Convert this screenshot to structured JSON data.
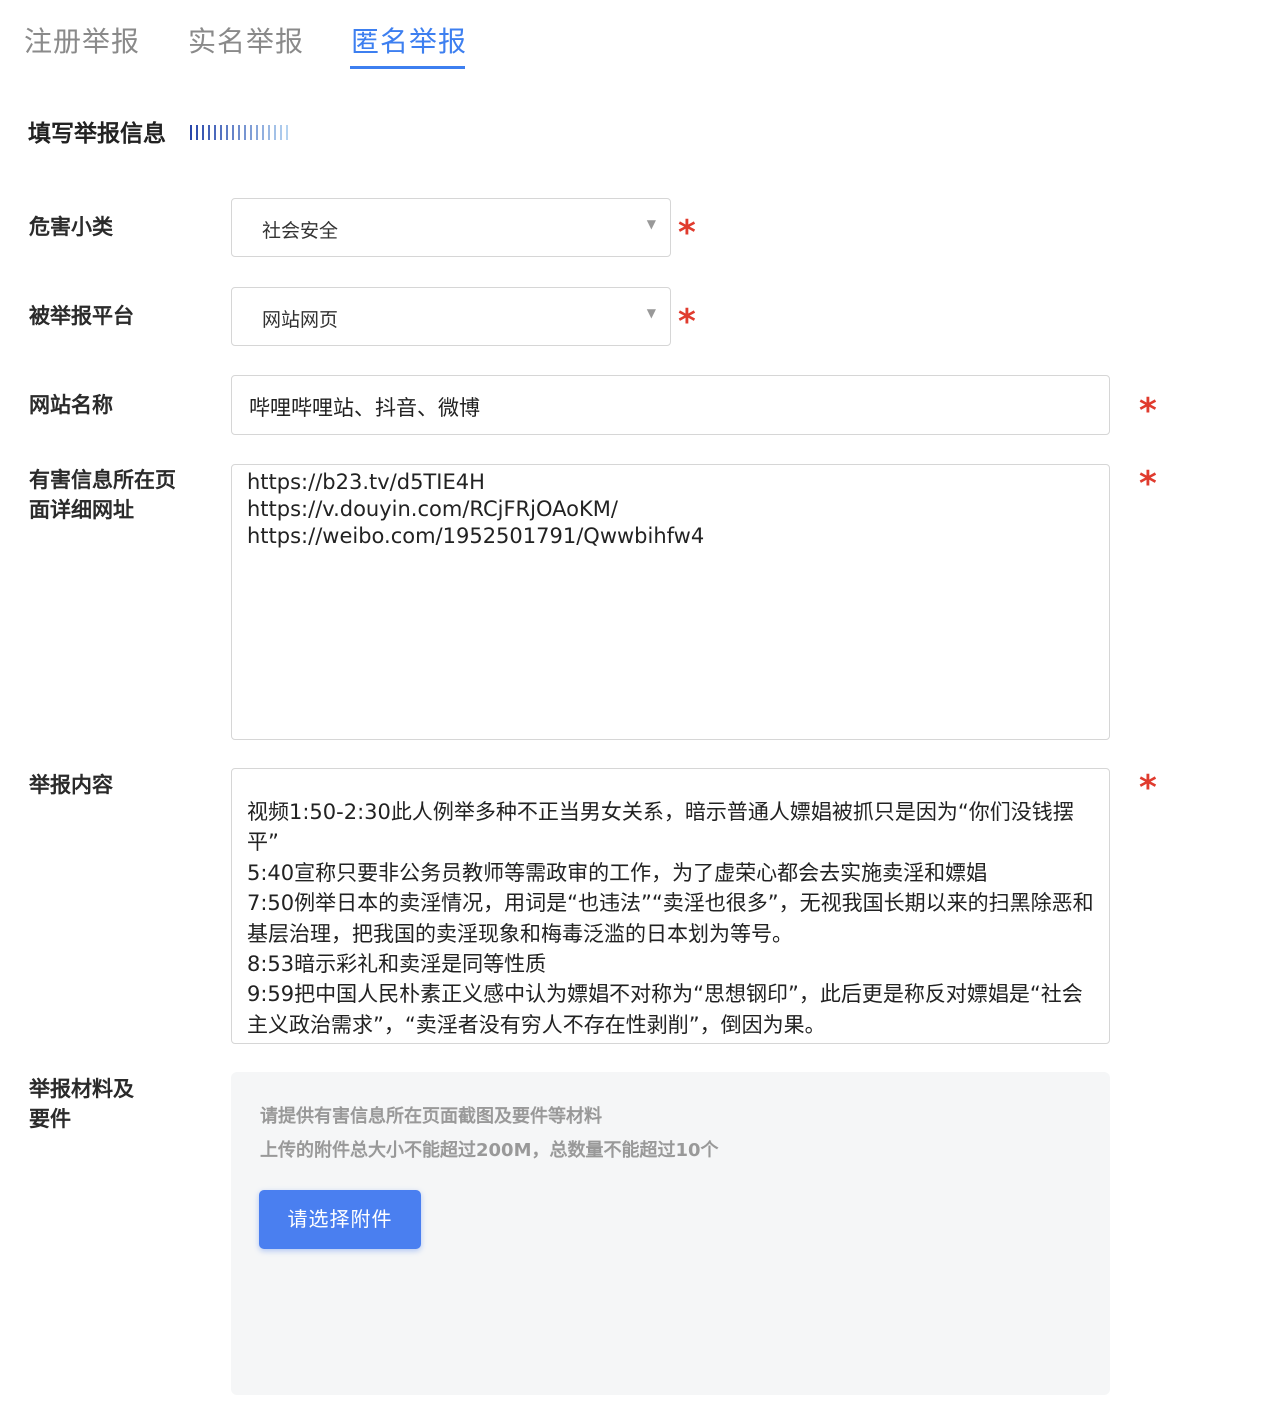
{
  "tabs": [
    {
      "label": "注册举报"
    },
    {
      "label": "实名举报"
    },
    {
      "label": "匿名举报"
    }
  ],
  "active_tab": "匿名举报",
  "accent_color": "#3d7ff0",
  "required_color": "#e03b2e",
  "section_title": "填写举报信息",
  "required_mark": "*",
  "fields": {
    "harm_category": {
      "label": "危害小类",
      "value": "社会安全"
    },
    "platform": {
      "label": "被举报平台",
      "value": "网站网页"
    },
    "site_name": {
      "label": "网站名称",
      "value": "哔哩哔哩站、抖音、微博"
    },
    "urls": {
      "label_line1": "有害信息所在页",
      "label_line2": "面详细网址",
      "lines": [
        "https://b23.tv/d5TIE4H",
        "https://v.douyin.com/RCjFRjOAoKM/",
        "https://weibo.com/1952501791/Qwwbihfw4"
      ]
    },
    "content": {
      "label": "举报内容",
      "lines": [
        "视频1:50-2:30此人例举多种不正当男女关系，暗示普通人嫖娼被抓只是因为“你们没钱摆平”",
        "5:40宣称只要非公务员教师等需政审的工作，为了虚荣心都会去实施卖淫和嫖娼",
        "7:50例举日本的卖淫情况，用词是“也违法”“卖淫也很多”，无视我国长期以来的扫黑除恶和基层治理，把我国的卖淫现象和梅毒泛滥的日本划为等号。",
        "8:53暗示彩礼和卖淫是同等性质",
        "9:59把中国人民朴素正义感中认为嫖娼不对称为“思想钢印”，此后更是称反对嫖娼是“社会主义政治需求”，“卖淫者没有穷人不存在性剥削”，倒因为果。"
      ]
    },
    "materials": {
      "label_line1": "举报材料及",
      "label_line2": "要件",
      "hint1": "请提供有害信息所在页面截图及要件等材料",
      "hint2": "上传的附件总大小不能超过200M，总数量不能超过10个",
      "button_label": "请选择附件"
    }
  }
}
